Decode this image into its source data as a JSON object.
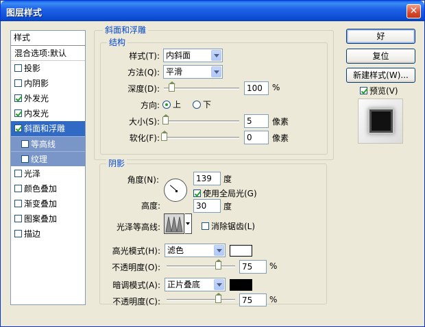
{
  "window": {
    "title": "图层样式",
    "close": "✕"
  },
  "sidebar": {
    "header": "样式",
    "blend": "混合选项:默认",
    "items": [
      {
        "label": "投影",
        "checked": false
      },
      {
        "label": "内阴影",
        "checked": false
      },
      {
        "label": "外发光",
        "checked": true
      },
      {
        "label": "内发光",
        "checked": true
      },
      {
        "label": "斜面和浮雕",
        "checked": true
      },
      {
        "label": "等高线",
        "checked": false
      },
      {
        "label": "纹理",
        "checked": false
      },
      {
        "label": "光泽",
        "checked": false
      },
      {
        "label": "颜色叠加",
        "checked": false
      },
      {
        "label": "渐变叠加",
        "checked": false
      },
      {
        "label": "图案叠加",
        "checked": false
      },
      {
        "label": "描边",
        "checked": false
      }
    ]
  },
  "bevel": {
    "group_title": "斜面和浮雕",
    "structure_title": "结构",
    "style_label": "样式(T):",
    "style_value": "内斜面",
    "technique_label": "方法(Q):",
    "technique_value": "平滑",
    "depth_label": "深度(D):",
    "depth_value": "100",
    "depth_unit": "%",
    "depth_slider": 0.1,
    "direction_label": "方向:",
    "dir_up": "上",
    "dir_down": "下",
    "size_label": "大小(S):",
    "size_value": "5",
    "size_unit": "像素",
    "size_slider": 0.02,
    "soften_label": "软化(F):",
    "soften_value": "0",
    "soften_unit": "像素",
    "soften_slider": 0.0
  },
  "shading": {
    "title": "阴影",
    "angle_label": "角度(N):",
    "angle_value": "139",
    "angle_unit": "度",
    "global_light_label": "使用全局光(G)",
    "altitude_label": "高度:",
    "altitude_value": "30",
    "altitude_unit": "度",
    "gloss_label": "光泽等高线:",
    "antialias_label": "消除锯齿(L)",
    "highlight_label": "高光模式(H):",
    "highlight_mode": "滤色",
    "highlight_color": "#ffffff",
    "highlight_opacity_label": "不透明度(O):",
    "highlight_opacity": "75",
    "highlight_slider": 0.75,
    "shadow_label": "暗调模式(A):",
    "shadow_mode": "正片叠底",
    "shadow_color": "#000000",
    "shadow_opacity_label": "不透明度(C):",
    "shadow_opacity": "75",
    "shadow_slider": 0.75,
    "pct": "%"
  },
  "buttons": {
    "ok": "好",
    "reset": "复位",
    "new_style": "新建样式(W)...",
    "preview": "预览(V)"
  },
  "colors": {
    "accent": "#316ac5",
    "legend": "#0046d5"
  }
}
